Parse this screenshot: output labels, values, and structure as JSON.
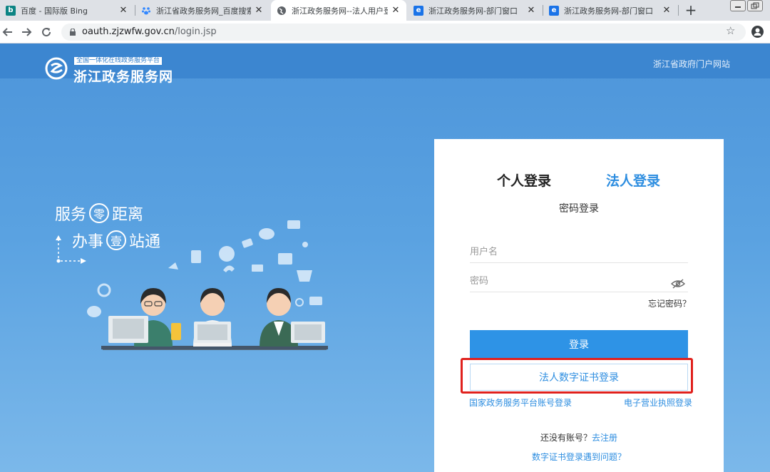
{
  "browser": {
    "tabs": [
      {
        "title": "百度 - 国际版 Bing",
        "favicon": "bing-icon",
        "color": "#0c8484"
      },
      {
        "title": "浙江省政务服务网_百度搜索",
        "favicon": "baidu-paw-icon",
        "color": "#3388ff"
      },
      {
        "title": "浙江政务服务网--法人用户登",
        "favicon": "globe-icon",
        "color": "#5f6368"
      },
      {
        "title": "浙江政务服务网-部门窗口",
        "favicon": "zj-service-icon",
        "color": "#1a73e8"
      },
      {
        "title": "浙江政务服务网-部门窗口",
        "favicon": "zj-service-icon",
        "color": "#1a73e8"
      }
    ],
    "new_tab": "+",
    "close_glyph": "✕",
    "address": {
      "host": "oauth.zjzwfw.gov.cn",
      "path": "/login.jsp"
    }
  },
  "header": {
    "logo_tagline": "全国一体化在线政务服务平台",
    "logo_name": "浙江政务服务网",
    "portal_link": "浙江省政府门户网站"
  },
  "hero": {
    "line1_a": "服务",
    "line1_circle": "零",
    "line1_b": "距离",
    "line2_a": "办事",
    "line2_circle": "壹",
    "line2_b": "站通"
  },
  "login": {
    "tab_personal": "个人登录",
    "tab_legal": "法人登录",
    "subtitle": "密码登录",
    "username_placeholder": "用户名",
    "password_placeholder": "密码",
    "forgot": "忘记密码？",
    "login_button": "登录",
    "cert_button": "法人数字证书登录",
    "national_link": "国家政务服务平台账号登录",
    "license_link": "电子营业执照登录",
    "no_account": "还没有账号？",
    "register_link": "去注册",
    "cert_help": "数字证书登录遇到问题？"
  },
  "colors": {
    "accent": "#2e8ee0",
    "highlight": "#e0211d",
    "page_bg": "#5aa2e1"
  }
}
